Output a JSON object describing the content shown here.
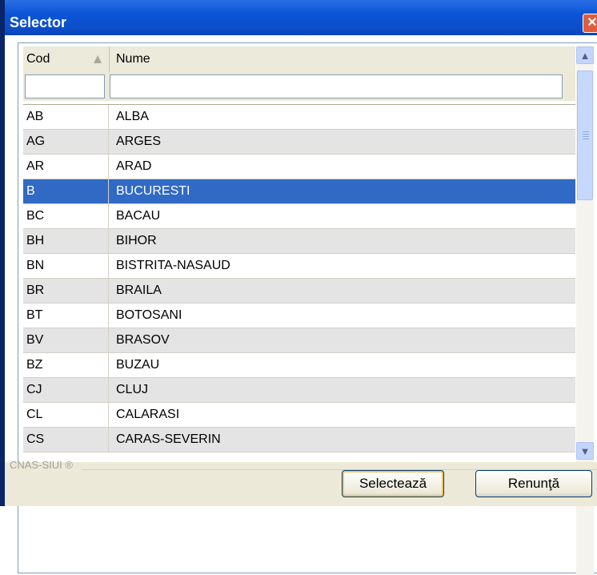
{
  "window": {
    "title": "Selector",
    "close_symbol": "✕"
  },
  "grid": {
    "columns": [
      "Cod",
      "Nume"
    ],
    "filter_values": {
      "cod": "",
      "nume": ""
    },
    "rows": [
      {
        "cod": "AB",
        "nume": "ALBA"
      },
      {
        "cod": "AG",
        "nume": "ARGES"
      },
      {
        "cod": "AR",
        "nume": "ARAD"
      },
      {
        "cod": "B",
        "nume": "BUCURESTI",
        "selected": true
      },
      {
        "cod": "BC",
        "nume": "BACAU"
      },
      {
        "cod": "BH",
        "nume": "BIHOR"
      },
      {
        "cod": "BN",
        "nume": "BISTRITA-NASAUD"
      },
      {
        "cod": "BR",
        "nume": "BRAILA"
      },
      {
        "cod": "BT",
        "nume": "BOTOSANI"
      },
      {
        "cod": "BV",
        "nume": "BRASOV"
      },
      {
        "cod": "BZ",
        "nume": "BUZAU"
      },
      {
        "cod": "CJ",
        "nume": "CLUJ"
      },
      {
        "cod": "CL",
        "nume": "CALARASI"
      },
      {
        "cod": "CS",
        "nume": "CARAS-SEVERIN"
      }
    ]
  },
  "footer": {
    "brand": "CNAS-SIUI ®",
    "select_label": "Selectează",
    "cancel_label": "Renunţă"
  },
  "colors": {
    "selected_row": "#316ac5",
    "titlebar": "#0a54d6"
  },
  "icons": {
    "sort": "sort-ascending-icon",
    "scroll_up": "chevron-up-icon",
    "scroll_down": "chevron-down-icon"
  }
}
